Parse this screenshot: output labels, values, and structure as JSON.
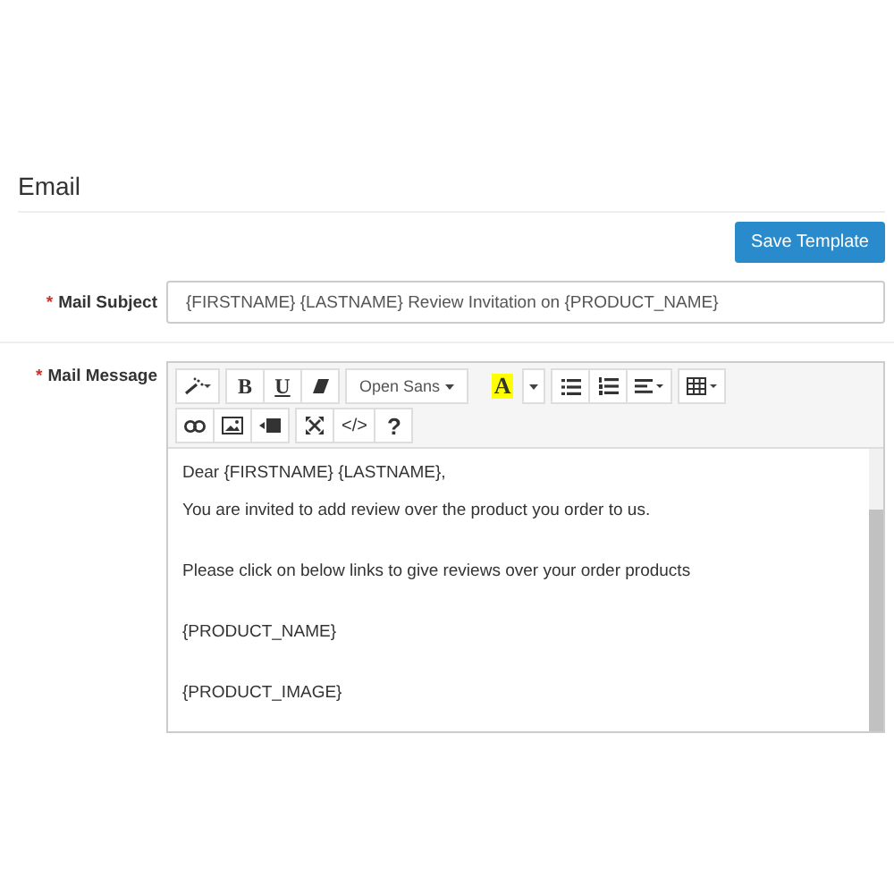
{
  "section": {
    "title": "Email"
  },
  "save_button": "Save Template",
  "subject": {
    "required_mark": "*",
    "label": "Mail Subject",
    "value": "{FIRSTNAME} {LASTNAME} Review Invitation on {PRODUCT_NAME}"
  },
  "message": {
    "required_mark": "*",
    "label": "Mail Message",
    "toolbar": [
      [
        [
          {
            "kind": "wand"
          }
        ],
        [
          {
            "kind": "bold",
            "label": "B"
          },
          {
            "kind": "underline",
            "label": "U"
          },
          {
            "kind": "eraser"
          }
        ],
        [
          {
            "kind": "font",
            "label": "Open Sans"
          }
        ],
        [
          {
            "kind": "highlight",
            "label": "A"
          },
          {
            "kind": "caret"
          }
        ],
        [
          {
            "kind": "ul"
          },
          {
            "kind": "ol"
          },
          {
            "kind": "align"
          }
        ],
        [
          {
            "kind": "table"
          }
        ]
      ],
      [
        [
          {
            "kind": "link"
          },
          {
            "kind": "image"
          },
          {
            "kind": "video"
          }
        ],
        [
          {
            "kind": "fullscreen"
          },
          {
            "kind": "code",
            "label": "</>"
          },
          {
            "kind": "help",
            "label": "?"
          }
        ]
      ]
    ],
    "lines": [
      "Dear {FIRSTNAME} {LASTNAME},",
      "You are invited to add review over the product you order to us.",
      "Please click on below links to give reviews over your order products",
      "{PRODUCT_NAME}",
      "{PRODUCT_IMAGE}"
    ]
  }
}
